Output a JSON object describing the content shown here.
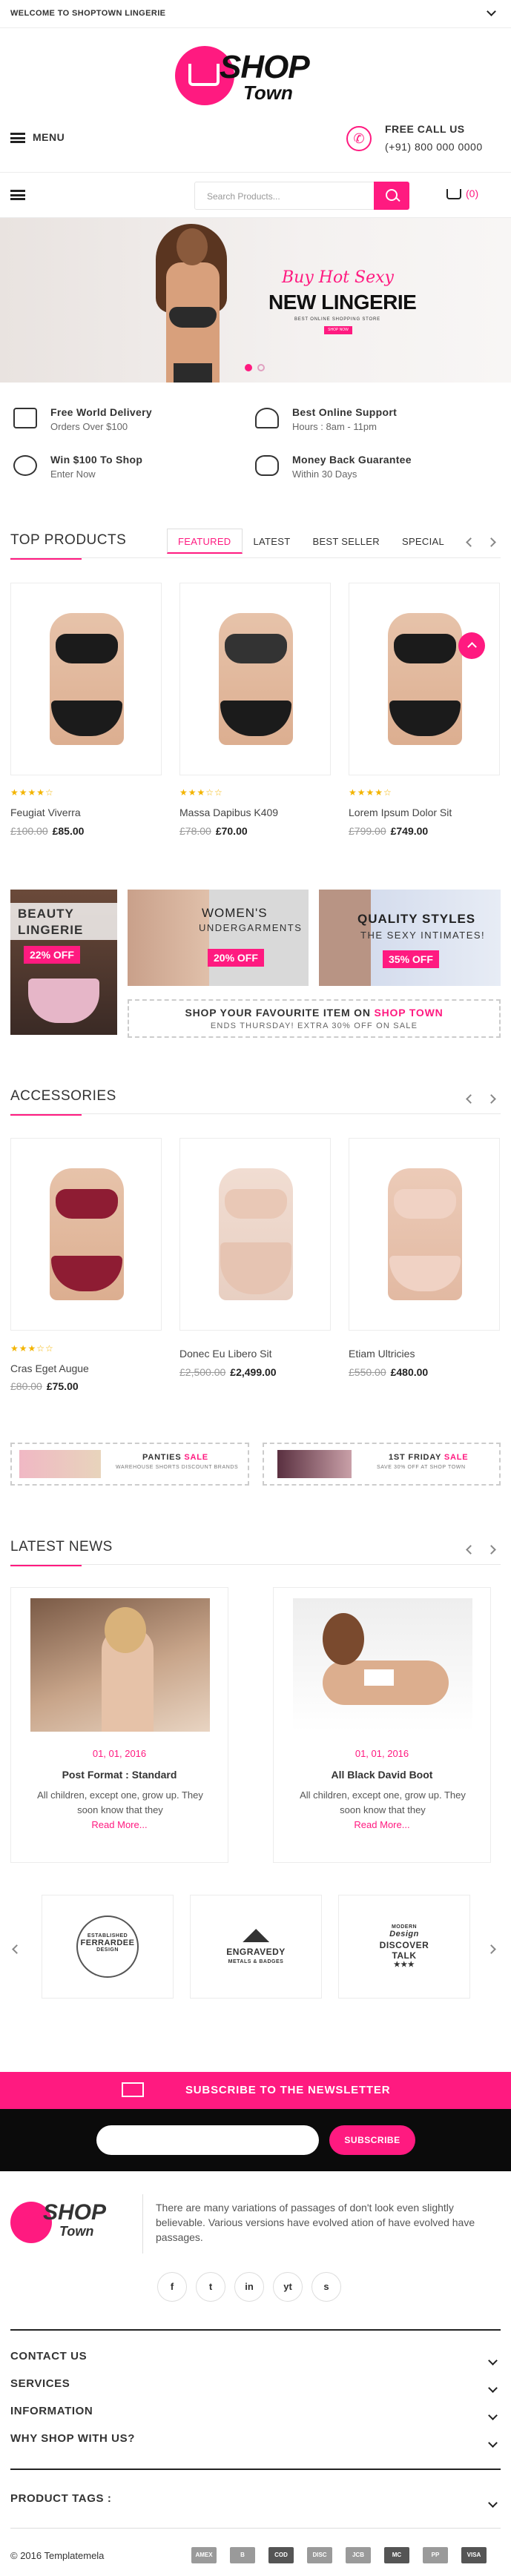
{
  "topbar": {
    "welcome": "WELCOME TO SHOPTOWN LINGERIE"
  },
  "logo": {
    "word1": "SHOP",
    "word2": "Town"
  },
  "header": {
    "menu_label": "MENU",
    "call_title": "FREE CALL US",
    "call_number": "(+91) 800 000 0000"
  },
  "search": {
    "placeholder": "Search Products...",
    "cart_count": "(0)"
  },
  "hero": {
    "script": "Buy Hot Sexy",
    "headline": "NEW LINGERIE",
    "subline": "BEST ONLINE SHOPPING STORE",
    "cta": "SHOP NOW"
  },
  "features": [
    {
      "title": "Free World Delivery",
      "desc": "Orders Over $100",
      "icon": "truck-icon"
    },
    {
      "title": "Best Online Support",
      "desc": "Hours : 8am - 11pm",
      "icon": "headset-icon"
    },
    {
      "title": "Win $100 To Shop",
      "desc": "Enter Now",
      "icon": "piggy-bank-icon"
    },
    {
      "title": "Money Back Guarantee",
      "desc": "Within 30 Days",
      "icon": "money-bag-icon"
    }
  ],
  "top_products": {
    "heading": "TOP PRODUCTS",
    "tabs": [
      "FEATURED",
      "LATEST",
      "BEST SELLER",
      "SPECIAL"
    ],
    "items": [
      {
        "name": "Feugiat Viverra",
        "old": "£100.00",
        "price": "£85.00",
        "rating": 4,
        "rating_text": "★★★★☆"
      },
      {
        "name": "Massa Dapibus K409",
        "old": "£78.00",
        "price": "£70.00",
        "rating": 3,
        "rating_text": "★★★☆☆"
      },
      {
        "name": "Lorem Ipsum Dolor Sit",
        "old": "£799.00",
        "price": "£749.00",
        "rating": 4,
        "rating_text": "★★★★☆"
      }
    ]
  },
  "promo": {
    "b1_line1": "BEAUTY",
    "b1_line2": "LINGERIE",
    "b1_tag": "22% OFF",
    "b2_line1": "WOMEN'S",
    "b2_line2": "UNDERGARMENTS",
    "b2_tag": "20% OFF",
    "b3_line1": "QUALITY STYLES",
    "b3_line2": "THE SEXY INTIMATES!",
    "b3_tag": "35% OFF",
    "strip_text": "SHOP YOUR FAVOURITE ITEM ON",
    "strip_brand": "SHOP TOWN",
    "strip_sub": "ENDS THURSDAY! EXTRA 30% OFF ON SALE"
  },
  "accessories": {
    "heading": "ACCESSORIES",
    "items": [
      {
        "name": "Cras Eget Augue",
        "old": "£80.00",
        "price": "£75.00",
        "rating": 3,
        "rating_text": "★★★☆☆"
      },
      {
        "name": "Donec Eu Libero Sit",
        "old": "£2,500.00",
        "price": "£2,499.00",
        "rating": 0,
        "rating_text": ""
      },
      {
        "name": "Etiam Ultricies",
        "old": "£550.00",
        "price": "£480.00",
        "rating": 0,
        "rating_text": ""
      }
    ]
  },
  "sale_banners": [
    {
      "title": "PANTIES",
      "tag": "SALE",
      "sub": "WAREHOUSE SHORTS DISCOUNT BRANDS"
    },
    {
      "title": "1ST FRIDAY",
      "tag": "SALE",
      "sub": "SAVE 30% OFF AT SHOP TOWN"
    }
  ],
  "news": {
    "heading": "LATEST NEWS",
    "items": [
      {
        "date": "01, 01, 2016",
        "title": "Post Format : Standard",
        "desc": "All children, except one, grow up. They soon know that they",
        "more": "Read More..."
      },
      {
        "date": "01, 01, 2016",
        "title": "All Black David Boot",
        "desc": "All children, except one, grow up. They soon know that they",
        "more": "Read More..."
      }
    ]
  },
  "brands": [
    {
      "top": "ESTABLISHED",
      "name": "FERRARDEE",
      "bottom": "DESIGN"
    },
    {
      "top": "",
      "name": "ENGRAVEDY",
      "bottom": "METALS & BADGES"
    },
    {
      "top": "MODERN",
      "name": "DISCOVER TALK",
      "bottom": "Design"
    }
  ],
  "newsletter": {
    "title": "SUBSCRIBE TO THE NEWSLETTER",
    "button": "SUBSCRIBE"
  },
  "footer": {
    "about": "There are many variations of passages of don't look even slightly believable. Various versions have evolved ation of have evolved have passages.",
    "social": [
      "f",
      "t",
      "in",
      "yt",
      "s"
    ],
    "accordions": [
      "CONTACT US",
      "SERVICES",
      "INFORMATION",
      "WHY SHOP WITH US?"
    ],
    "tags_label": "PRODUCT TAGS :",
    "copyright": "© 2016 Templatemela",
    "payments": [
      "AMEX",
      "B",
      "COD",
      "DISC",
      "JCB",
      "MC",
      "PP",
      "VISA"
    ]
  },
  "colors": {
    "accent": "#ff1a80",
    "dark": "#0b0b0b"
  }
}
